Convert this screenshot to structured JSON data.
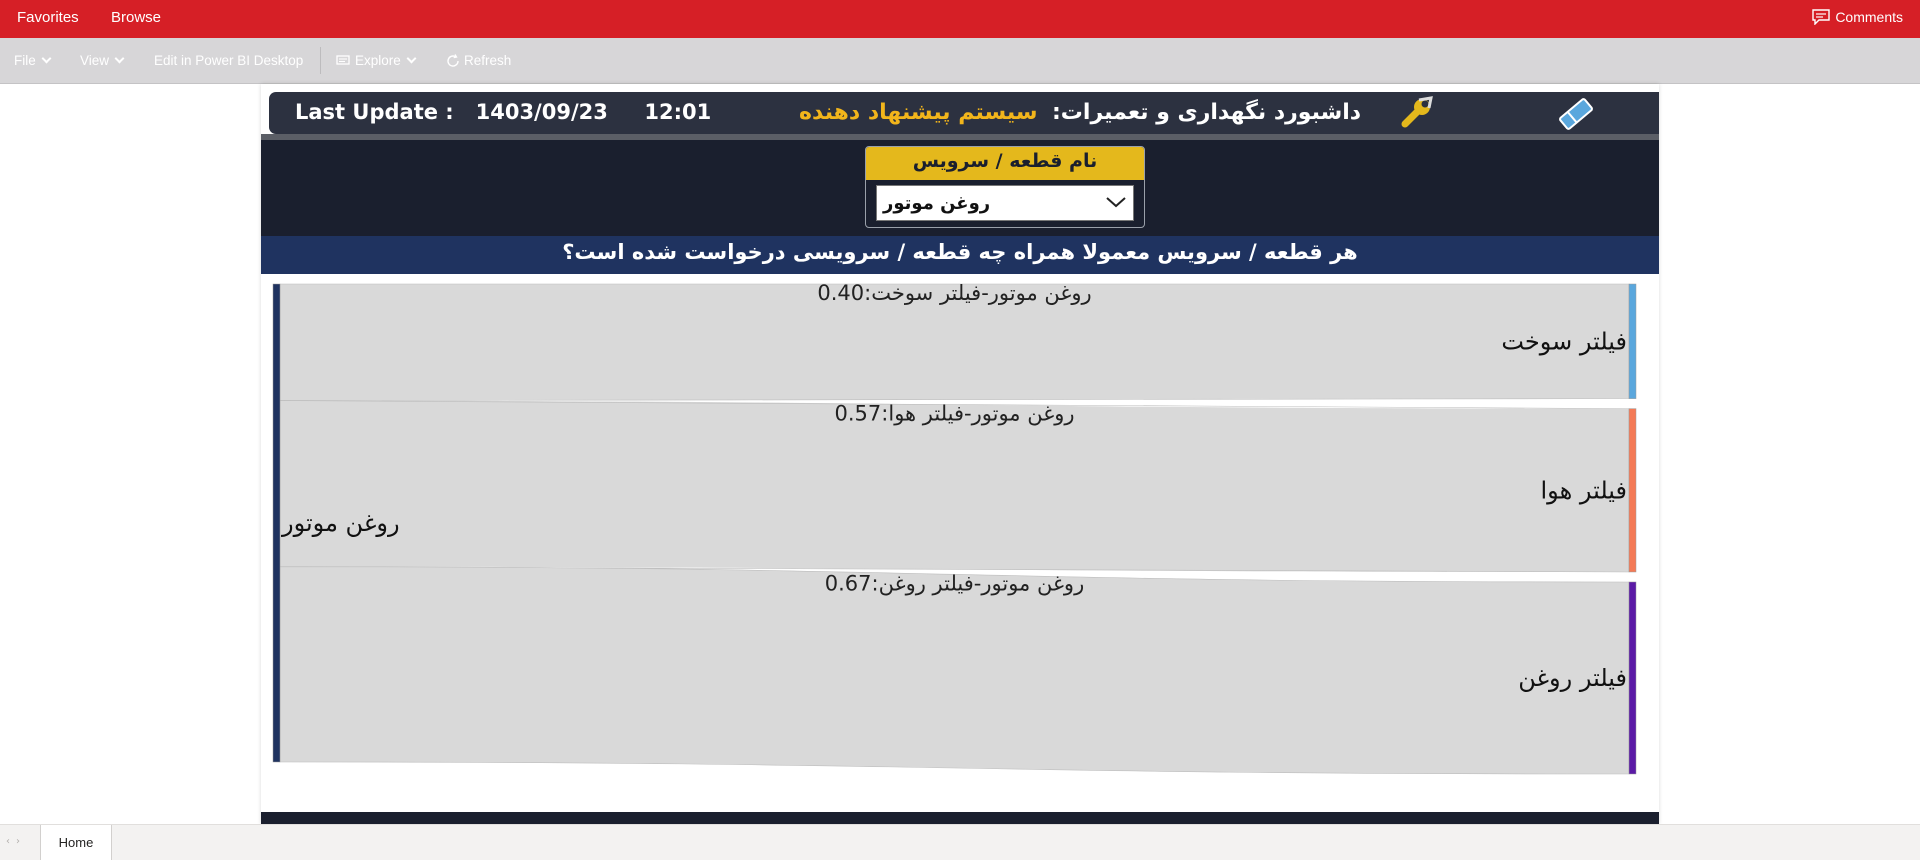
{
  "topbar": {
    "favorites": "Favorites",
    "browse": "Browse",
    "comments": "Comments"
  },
  "toolbar": {
    "file": "File",
    "view": "View",
    "edit": "Edit in Power BI Desktop",
    "explore": "Explore",
    "refresh": "Refresh"
  },
  "header": {
    "last_update": "Last Update :   1403/09/23     12:01",
    "title_main": "داشبورد نگهداری و تعمیرات:",
    "title_accent": "سیستم پیشنهاد دهنده"
  },
  "slicer": {
    "title": "نام قطعه / سرویس",
    "value": "روغن موتور"
  },
  "question": "هر قطعه / سرویس معمولا همراه چه قطعه / سرویسی درخواست شده است؟",
  "chart_data": {
    "type": "sankey",
    "source": "روغن موتور",
    "links": [
      {
        "target": "فیلتر سوخت",
        "label": "روغن موتور-فیلتر سوخت:0.40",
        "value": 0.4,
        "color": "#5aa7dd"
      },
      {
        "target": "فیلتر هوا",
        "label": "روغن موتور-فیلتر هوا:0.57",
        "value": 0.57,
        "color": "#f47a56"
      },
      {
        "target": "فیلتر روغن",
        "label": "روغن موتور-فیلتر روغن:0.67",
        "value": 0.67,
        "color": "#5b1aa6"
      }
    ],
    "source_color": "#1f3360"
  },
  "tabs": {
    "home": "Home"
  }
}
